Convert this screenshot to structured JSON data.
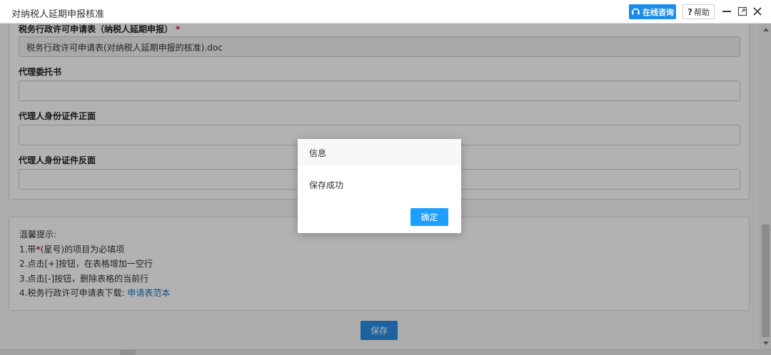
{
  "window": {
    "title": "对纳税人延期申报核准",
    "consult_label": "在线咨询",
    "help_label": "帮助",
    "help_mark": "?",
    "icons": [
      "headset-icon",
      "minimize-icon",
      "maximize-icon",
      "close-icon"
    ]
  },
  "form": {
    "fields": [
      {
        "label": "税务行政许可申请表（纳税人延期申报）",
        "required_mark": "*",
        "value": "税务行政许可申请表(对纳税人延期申报的核准).doc"
      },
      {
        "label": "代理委托书",
        "value": ""
      },
      {
        "label": "代理人身份证件正面",
        "value": ""
      },
      {
        "label": "代理人身份证件反面",
        "value": ""
      }
    ]
  },
  "tips": {
    "title": "温馨提示:",
    "line1_prefix": "1.带",
    "line1_star": "*",
    "line1_suffix": "(星号)的项目为必填项",
    "line2": "2.点击[+]按钮，在表格增加一空行",
    "line3": "3.点击[-]按钮，删除表格的当前行",
    "line4_prefix": "4.税务行政许可申请表下载:",
    "line4_link": "申请表范本"
  },
  "actions": {
    "save_label": "保存"
  },
  "dialog": {
    "title": "信息",
    "message": "保存成功",
    "ok_label": "确定"
  },
  "colors": {
    "primary": "#1e9fff",
    "required": "#e0202a",
    "link": "#1e74c8"
  }
}
